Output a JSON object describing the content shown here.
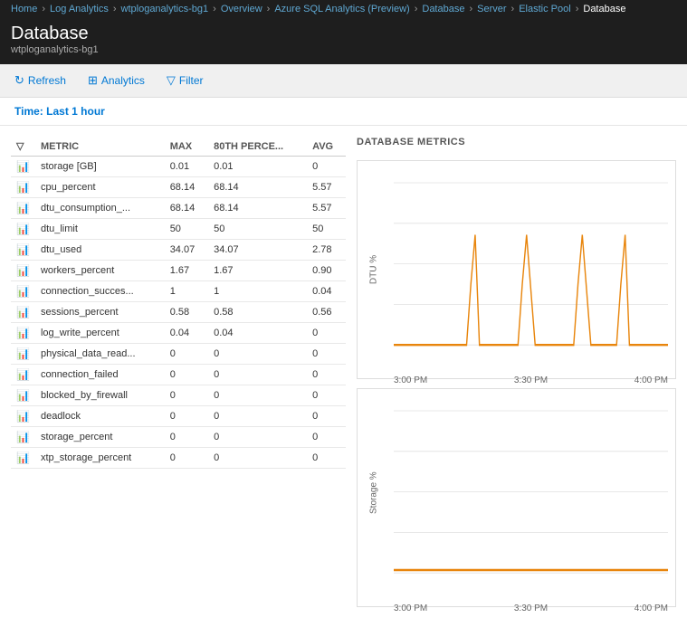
{
  "breadcrumb": {
    "items": [
      {
        "label": "Home",
        "active": false
      },
      {
        "label": "Log Analytics",
        "active": false
      },
      {
        "label": "wtploganalytics-bg1",
        "active": false
      },
      {
        "label": "Overview",
        "active": false
      },
      {
        "label": "Azure SQL Analytics (Preview)",
        "active": false
      },
      {
        "label": "Database",
        "active": false
      },
      {
        "label": "Server",
        "active": false
      },
      {
        "label": "Elastic Pool",
        "active": false
      },
      {
        "label": "Database",
        "active": true
      }
    ]
  },
  "page": {
    "title": "Database",
    "subtitle": "wtploganalytics-bg1"
  },
  "toolbar": {
    "refresh_label": "Refresh",
    "analytics_label": "Analytics",
    "filter_label": "Filter"
  },
  "time_bar": {
    "label": "Time:",
    "value": "Last 1 hour"
  },
  "table": {
    "headers": [
      "",
      "METRIC",
      "MAX",
      "80TH PERCE...",
      "AVG"
    ],
    "rows": [
      {
        "metric": "storage [GB]",
        "max": "0.01",
        "p80": "0.01",
        "avg": "0"
      },
      {
        "metric": "cpu_percent",
        "max": "68.14",
        "p80": "68.14",
        "avg": "5.57"
      },
      {
        "metric": "dtu_consumption_...",
        "max": "68.14",
        "p80": "68.14",
        "avg": "5.57"
      },
      {
        "metric": "dtu_limit",
        "max": "50",
        "p80": "50",
        "avg": "50"
      },
      {
        "metric": "dtu_used",
        "max": "34.07",
        "p80": "34.07",
        "avg": "2.78"
      },
      {
        "metric": "workers_percent",
        "max": "1.67",
        "p80": "1.67",
        "avg": "0.90"
      },
      {
        "metric": "connection_succes...",
        "max": "1",
        "p80": "1",
        "avg": "0.04"
      },
      {
        "metric": "sessions_percent",
        "max": "0.58",
        "p80": "0.58",
        "avg": "0.56"
      },
      {
        "metric": "log_write_percent",
        "max": "0.04",
        "p80": "0.04",
        "avg": "0"
      },
      {
        "metric": "physical_data_read...",
        "max": "0",
        "p80": "0",
        "avg": "0"
      },
      {
        "metric": "connection_failed",
        "max": "0",
        "p80": "0",
        "avg": "0"
      },
      {
        "metric": "blocked_by_firewall",
        "max": "0",
        "p80": "0",
        "avg": "0"
      },
      {
        "metric": "deadlock",
        "max": "0",
        "p80": "0",
        "avg": "0"
      },
      {
        "metric": "storage_percent",
        "max": "0",
        "p80": "0",
        "avg": "0"
      },
      {
        "metric": "xtp_storage_percent",
        "max": "0",
        "p80": "0",
        "avg": "0"
      }
    ]
  },
  "charts": {
    "section_title": "DATABASE METRICS",
    "chart1": {
      "y_label": "DTU %",
      "x_labels": [
        "3:00 PM",
        "3:30 PM",
        "4:00 PM"
      ],
      "y_ticks": [
        "100",
        "80",
        "60",
        "40",
        "20"
      ]
    },
    "chart2": {
      "y_label": "Storage %",
      "x_labels": [
        "3:00 PM",
        "3:30 PM",
        "4:00 PM"
      ],
      "y_ticks": [
        "100",
        "80",
        "60",
        "40",
        "20"
      ]
    }
  },
  "colors": {
    "accent_blue": "#0078d4",
    "orange": "#e8850c",
    "header_bg": "#1e1e1e",
    "toolbar_bg": "#f0f0f0"
  }
}
